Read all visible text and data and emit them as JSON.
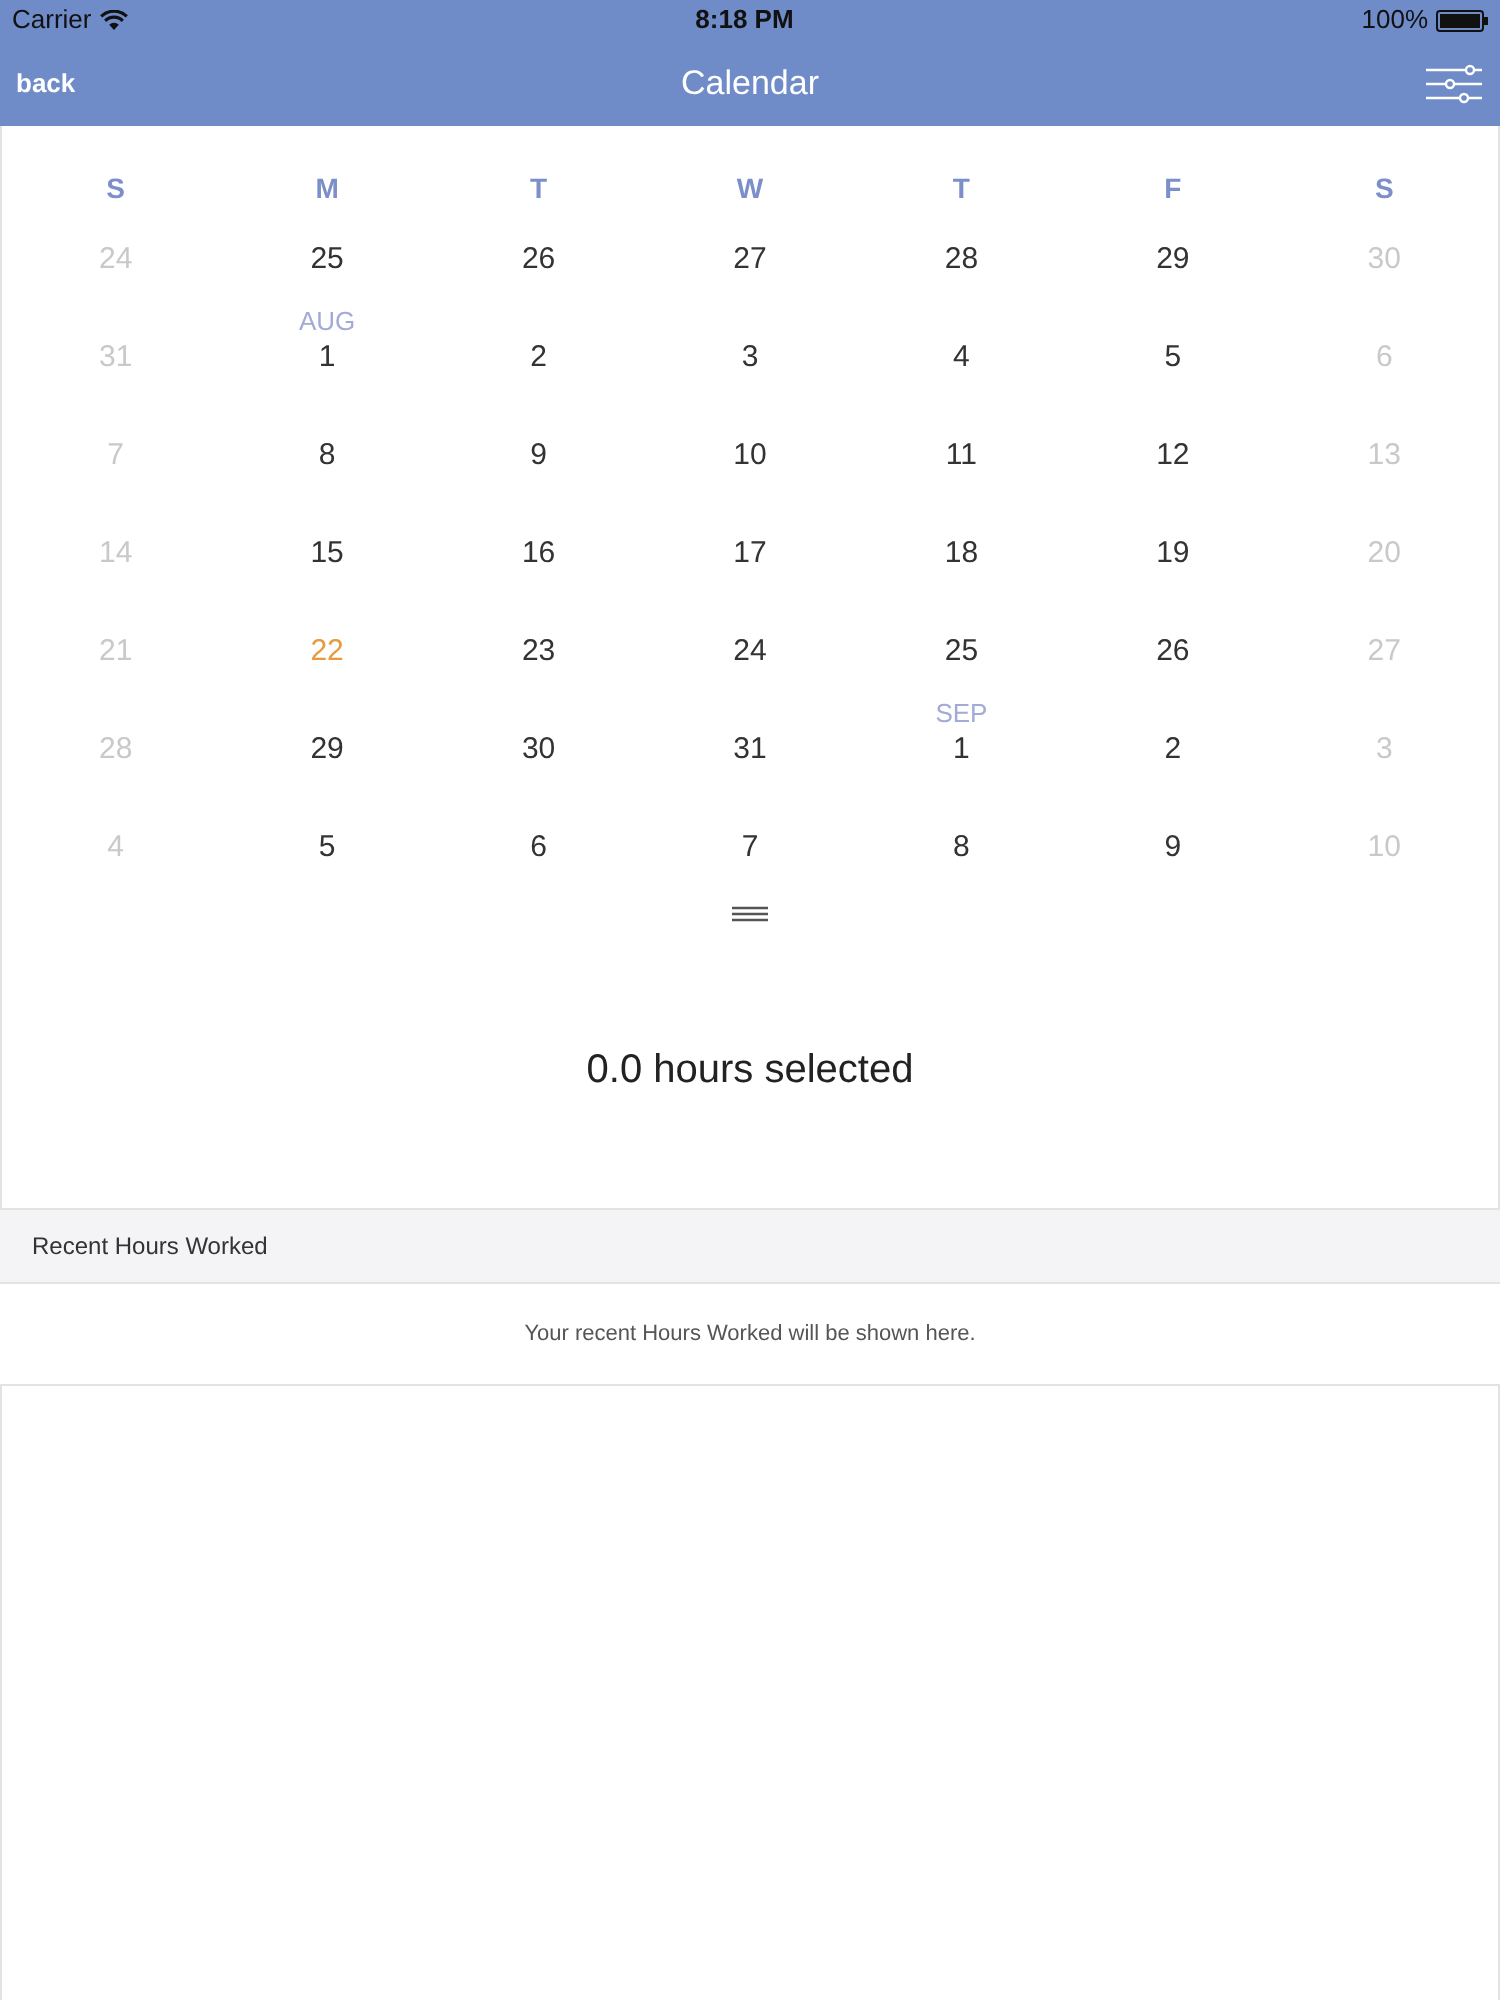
{
  "status_bar": {
    "carrier": "Carrier",
    "time": "8:18 PM",
    "battery": "100%"
  },
  "nav_bar": {
    "back": "back",
    "title": "Calendar"
  },
  "calendar": {
    "weekdays": [
      "S",
      "M",
      "T",
      "W",
      "T",
      "F",
      "S"
    ],
    "weeks": [
      [
        {
          "day": "24",
          "disabled": true,
          "today": false
        },
        {
          "day": "25",
          "disabled": false,
          "today": false
        },
        {
          "day": "26",
          "disabled": false,
          "today": false
        },
        {
          "day": "27",
          "disabled": false,
          "today": false
        },
        {
          "day": "28",
          "disabled": false,
          "today": false
        },
        {
          "day": "29",
          "disabled": false,
          "today": false
        },
        {
          "day": "30",
          "disabled": true,
          "today": false
        }
      ],
      [
        {
          "day": "31",
          "disabled": true,
          "today": false
        },
        {
          "day": "1",
          "month_label": "AUG",
          "disabled": false,
          "today": false
        },
        {
          "day": "2",
          "disabled": false,
          "today": false
        },
        {
          "day": "3",
          "disabled": false,
          "today": false
        },
        {
          "day": "4",
          "disabled": false,
          "today": false
        },
        {
          "day": "5",
          "disabled": false,
          "today": false
        },
        {
          "day": "6",
          "disabled": true,
          "today": false
        }
      ],
      [
        {
          "day": "7",
          "disabled": true,
          "today": false
        },
        {
          "day": "8",
          "disabled": false,
          "today": false
        },
        {
          "day": "9",
          "disabled": false,
          "today": false
        },
        {
          "day": "10",
          "disabled": false,
          "today": false
        },
        {
          "day": "11",
          "disabled": false,
          "today": false
        },
        {
          "day": "12",
          "disabled": false,
          "today": false
        },
        {
          "day": "13",
          "disabled": true,
          "today": false
        }
      ],
      [
        {
          "day": "14",
          "disabled": true,
          "today": false
        },
        {
          "day": "15",
          "disabled": false,
          "today": false
        },
        {
          "day": "16",
          "disabled": false,
          "today": false
        },
        {
          "day": "17",
          "disabled": false,
          "today": false
        },
        {
          "day": "18",
          "disabled": false,
          "today": false
        },
        {
          "day": "19",
          "disabled": false,
          "today": false
        },
        {
          "day": "20",
          "disabled": true,
          "today": false
        }
      ],
      [
        {
          "day": "21",
          "disabled": true,
          "today": false
        },
        {
          "day": "22",
          "disabled": false,
          "today": true
        },
        {
          "day": "23",
          "disabled": false,
          "today": false
        },
        {
          "day": "24",
          "disabled": false,
          "today": false
        },
        {
          "day": "25",
          "disabled": false,
          "today": false
        },
        {
          "day": "26",
          "disabled": false,
          "today": false
        },
        {
          "day": "27",
          "disabled": true,
          "today": false
        }
      ],
      [
        {
          "day": "28",
          "disabled": true,
          "today": false
        },
        {
          "day": "29",
          "disabled": false,
          "today": false
        },
        {
          "day": "30",
          "disabled": false,
          "today": false
        },
        {
          "day": "31",
          "disabled": false,
          "today": false
        },
        {
          "day": "1",
          "month_label": "SEP",
          "disabled": false,
          "today": false
        },
        {
          "day": "2",
          "disabled": false,
          "today": false
        },
        {
          "day": "3",
          "disabled": true,
          "today": false
        }
      ],
      [
        {
          "day": "4",
          "disabled": true,
          "today": false
        },
        {
          "day": "5",
          "disabled": false,
          "today": false
        },
        {
          "day": "6",
          "disabled": false,
          "today": false
        },
        {
          "day": "7",
          "disabled": false,
          "today": false
        },
        {
          "day": "8",
          "disabled": false,
          "today": false
        },
        {
          "day": "9",
          "disabled": false,
          "today": false
        },
        {
          "day": "10",
          "disabled": true,
          "today": false
        }
      ]
    ]
  },
  "hours_summary": "0.0 hours selected",
  "recent": {
    "header": "Recent Hours Worked",
    "empty_message": "Your recent Hours Worked will be shown here."
  }
}
